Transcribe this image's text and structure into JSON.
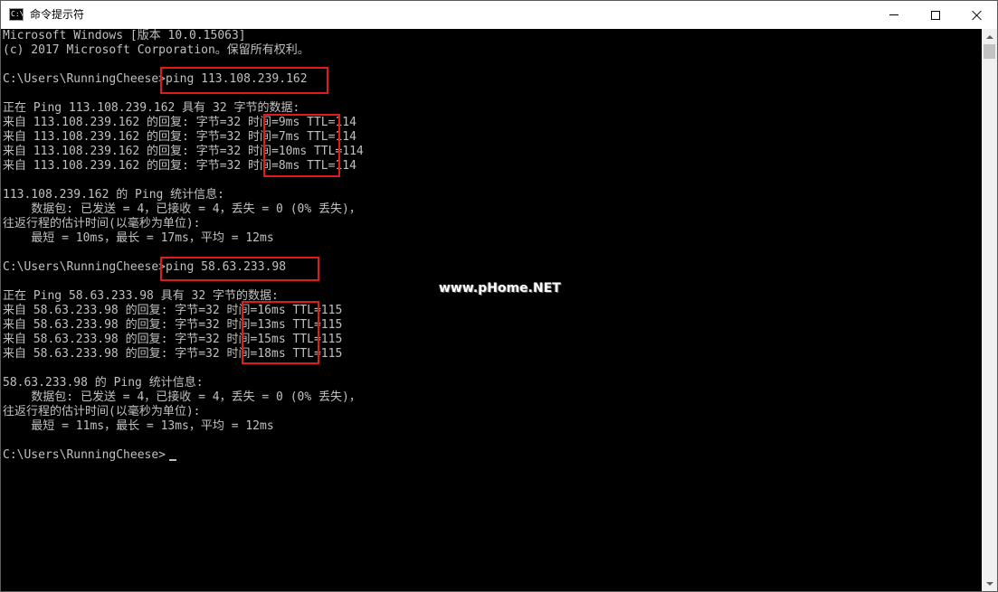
{
  "window": {
    "title": "命令提示符",
    "app_icon_text": "C:\\"
  },
  "console": {
    "lines": [
      "Microsoft Windows [版本 10.0.15063]",
      "(c) 2017 Microsoft Corporation。保留所有权利。",
      "",
      "C:\\Users\\RunningCheese>ping 113.108.239.162",
      "",
      "正在 Ping 113.108.239.162 具有 32 字节的数据:",
      "来自 113.108.239.162 的回复: 字节=32 时间=9ms TTL=114",
      "来自 113.108.239.162 的回复: 字节=32 时间=7ms TTL=114",
      "来自 113.108.239.162 的回复: 字节=32 时间=10ms TTL=114",
      "来自 113.108.239.162 的回复: 字节=32 时间=8ms TTL=114",
      "",
      "113.108.239.162 的 Ping 统计信息:",
      "    数据包: 已发送 = 4，已接收 = 4，丢失 = 0 (0% 丢失)，",
      "往返行程的估计时间(以毫秒为单位):",
      "    最短 = 10ms，最长 = 17ms，平均 = 12ms",
      "",
      "C:\\Users\\RunningCheese>ping 58.63.233.98",
      "",
      "正在 Ping 58.63.233.98 具有 32 字节的数据:",
      "来自 58.63.233.98 的回复: 字节=32 时间=16ms TTL=115",
      "来自 58.63.233.98 的回复: 字节=32 时间=13ms TTL=115",
      "来自 58.63.233.98 的回复: 字节=32 时间=15ms TTL=115",
      "来自 58.63.233.98 的回复: 字节=32 时间=18ms TTL=115",
      "",
      "58.63.233.98 的 Ping 统计信息:",
      "    数据包: 已发送 = 4，已接收 = 4，丢失 = 0 (0% 丢失)，",
      "往返行程的估计时间(以毫秒为单位):",
      "    最短 = 11ms，最长 = 13ms，平均 = 12ms",
      "",
      "C:\\Users\\RunningCheese>"
    ]
  },
  "watermark": "www.pHome.NET",
  "colors": {
    "console_bg": "#000000",
    "console_text": "#c0c0c0",
    "highlight_border": "#e01b1b",
    "titlebar_bg": "#ffffff"
  },
  "icons": {
    "minimize": "minimize-icon",
    "maximize": "maximize-icon",
    "close": "close-icon"
  }
}
